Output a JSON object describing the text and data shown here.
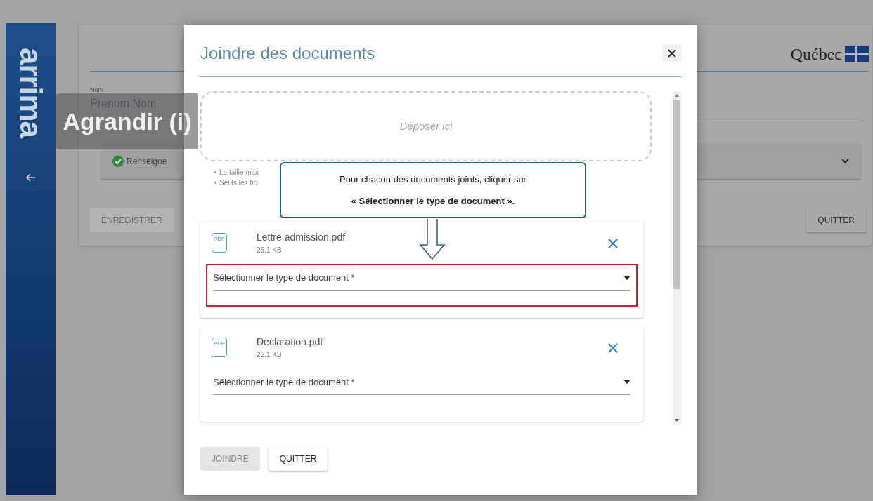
{
  "brand": {
    "logo": "arrima"
  },
  "header": {
    "government_logo": "Québec"
  },
  "form": {
    "name_label": "Nom",
    "name_value": "Prenom Nom",
    "status_label": "Renseigne",
    "save_button": "ENREGISTRER",
    "quit_button": "QUITTER"
  },
  "player_tooltip": "Agrandir (i)",
  "dialog": {
    "title": "Joindre des documents",
    "dropzone": "Déposer ici",
    "notes": [
      "La taille max",
      "Seuls les fic"
    ],
    "files": [
      {
        "icon_label": "PDF",
        "name": "Lettre admission.pdf",
        "size": "25.1 KB",
        "type_placeholder": "Sélectionner le type de document *",
        "highlighted": true
      },
      {
        "icon_label": "PDF",
        "name": "Declaration.pdf",
        "size": "25.1 KB",
        "type_placeholder": "Sélectionner le type de document *",
        "highlighted": false
      }
    ],
    "buttons": [
      {
        "label": "JOINDRE",
        "disabled": true
      },
      {
        "label": "QUITTER",
        "disabled": false
      }
    ]
  },
  "callout": {
    "line_1": "Pour chacun des documents joints, cliquer sur",
    "line_2": "« Sélectionner le type de document »."
  }
}
